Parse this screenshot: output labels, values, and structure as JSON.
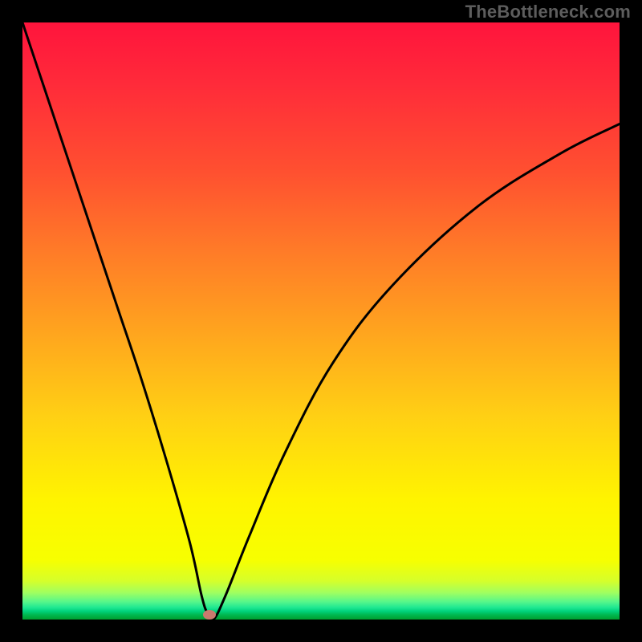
{
  "watermark": "TheBottleneck.com",
  "colors": {
    "page_bg": "#000000",
    "gradient_top": "#ff143c",
    "gradient_mid": "#fff400",
    "gradient_bottom": "#009e2e",
    "curve": "#000000",
    "marker": "#c97a6e"
  },
  "chart_data": {
    "type": "line",
    "title": "",
    "xlabel": "",
    "ylabel": "",
    "xlim": [
      0,
      100
    ],
    "ylim": [
      0,
      100
    ],
    "grid": false,
    "series": [
      {
        "name": "curve",
        "x": [
          0,
          4,
          8,
          12,
          16,
          20,
          24,
          28,
          30,
          31,
          32,
          34,
          38,
          44,
          52,
          62,
          76,
          90,
          100
        ],
        "y": [
          100,
          88,
          76,
          64,
          52,
          40,
          27,
          13,
          4,
          1,
          0,
          4,
          14,
          28,
          43,
          56,
          69,
          78,
          83
        ]
      }
    ],
    "marker": {
      "x": 31.3,
      "y": 0.8
    }
  }
}
